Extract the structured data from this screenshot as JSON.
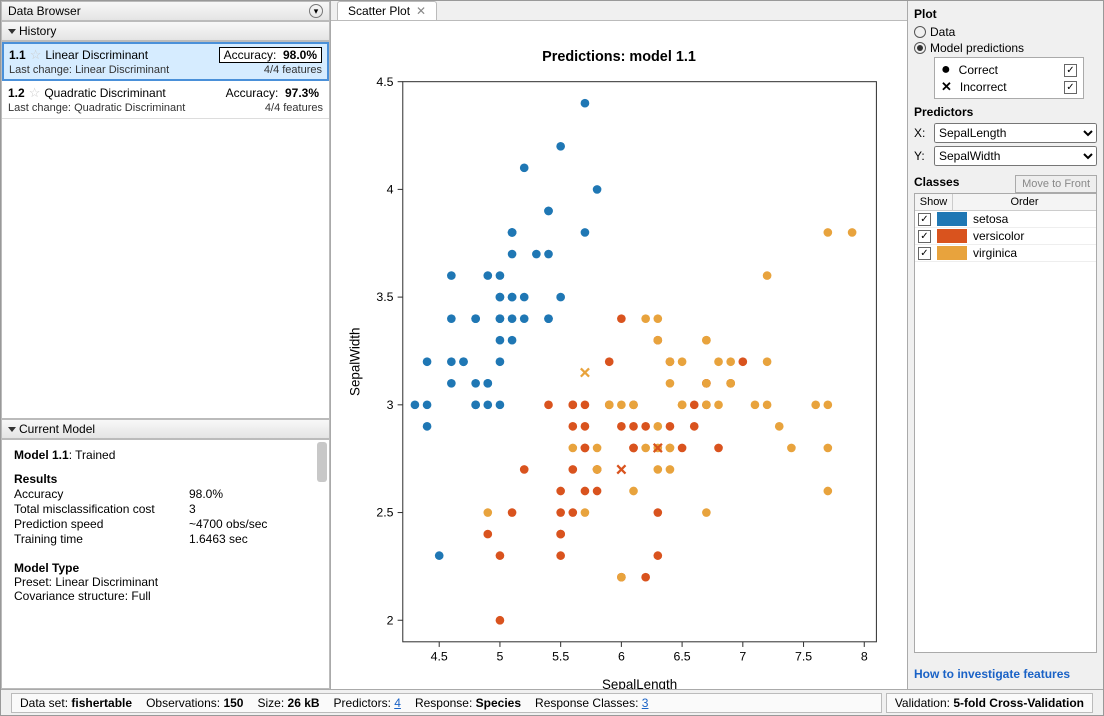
{
  "data_browser_title": "Data Browser",
  "history": {
    "title": "History",
    "items": [
      {
        "id": "1.1",
        "name": "Linear Discriminant",
        "accuracy_label": "Accuracy:",
        "accuracy": "98.0%",
        "last_change_label": "Last change:",
        "last_change": "Linear Discriminant",
        "features": "4/4 features",
        "selected": true
      },
      {
        "id": "1.2",
        "name": "Quadratic Discriminant",
        "accuracy_label": "Accuracy:",
        "accuracy": "97.3%",
        "last_change_label": "Last change:",
        "last_change": "Quadratic Discriminant",
        "features": "4/4 features",
        "selected": false
      }
    ]
  },
  "current_model": {
    "title": "Current Model",
    "heading_model": "Model 1.1",
    "heading_status": ": Trained",
    "results_label": "Results",
    "rows": [
      {
        "k": "Accuracy",
        "v": "98.0%"
      },
      {
        "k": "Total misclassification cost",
        "v": "3"
      },
      {
        "k": "Prediction speed",
        "v": "~4700 obs/sec"
      },
      {
        "k": "Training time",
        "v": "1.6463 sec"
      }
    ],
    "model_type_label": "Model Type",
    "preset": "Preset: Linear Discriminant",
    "cov": "Covariance structure: Full"
  },
  "tab": {
    "label": "Scatter Plot"
  },
  "plot_panel": {
    "title": "Plot",
    "radio_data": "Data",
    "radio_model": "Model predictions",
    "legend_correct": "Correct",
    "legend_incorrect": "Incorrect"
  },
  "predictors_panel": {
    "title": "Predictors",
    "x_label": "X:",
    "y_label": "Y:",
    "x_value": "SepalLength",
    "y_value": "SepalWidth"
  },
  "classes_panel": {
    "title": "Classes",
    "move_btn": "Move to Front",
    "col_show": "Show",
    "col_order": "Order",
    "rows": [
      {
        "name": "setosa",
        "color": "#1f77b4"
      },
      {
        "name": "versicolor",
        "color": "#d9531e"
      },
      {
        "name": "virginica",
        "color": "#e8a33d"
      }
    ]
  },
  "help_link": "How to investigate features",
  "status": {
    "dataset_label": "Data set:",
    "dataset": "fishertable",
    "obs_label": "Observations:",
    "obs": "150",
    "size_label": "Size:",
    "size": "26 kB",
    "pred_label": "Predictors:",
    "pred": "4",
    "resp_label": "Response:",
    "resp": "Species",
    "respcls_label": "Response Classes:",
    "respcls": "3",
    "val_label": "Validation:",
    "val": "5-fold Cross-Validation"
  },
  "chart_data": {
    "type": "scatter",
    "title": "Predictions: model 1.1",
    "xlabel": "SepalLength",
    "ylabel": "SepalWidth",
    "xlim": [
      4.2,
      8.1
    ],
    "ylim": [
      1.9,
      4.5
    ],
    "xticks": [
      4.5,
      5,
      5.5,
      6,
      6.5,
      7,
      7.5,
      8
    ],
    "yticks": [
      2,
      2.5,
      3,
      3.5,
      4,
      4.5
    ],
    "series": [
      {
        "name": "setosa",
        "color": "#1f77b4",
        "symbol": "dot",
        "points": [
          [
            5.1,
            3.5
          ],
          [
            4.9,
            3.0
          ],
          [
            4.7,
            3.2
          ],
          [
            4.6,
            3.1
          ],
          [
            5.0,
            3.6
          ],
          [
            5.4,
            3.9
          ],
          [
            4.6,
            3.4
          ],
          [
            5.0,
            3.4
          ],
          [
            4.4,
            2.9
          ],
          [
            4.9,
            3.1
          ],
          [
            5.4,
            3.7
          ],
          [
            4.8,
            3.4
          ],
          [
            4.8,
            3.0
          ],
          [
            4.3,
            3.0
          ],
          [
            5.8,
            4.0
          ],
          [
            5.7,
            4.4
          ],
          [
            5.4,
            3.9
          ],
          [
            5.1,
            3.5
          ],
          [
            5.7,
            3.8
          ],
          [
            5.1,
            3.8
          ],
          [
            5.4,
            3.4
          ],
          [
            5.1,
            3.7
          ],
          [
            4.6,
            3.6
          ],
          [
            5.1,
            3.3
          ],
          [
            4.8,
            3.4
          ],
          [
            5.0,
            3.0
          ],
          [
            5.0,
            3.4
          ],
          [
            5.2,
            3.5
          ],
          [
            5.2,
            3.4
          ],
          [
            4.7,
            3.2
          ],
          [
            4.8,
            3.1
          ],
          [
            5.4,
            3.4
          ],
          [
            5.2,
            4.1
          ],
          [
            5.5,
            4.2
          ],
          [
            4.9,
            3.1
          ],
          [
            5.0,
            3.2
          ],
          [
            5.5,
            3.5
          ],
          [
            4.9,
            3.6
          ],
          [
            4.4,
            3.0
          ],
          [
            5.1,
            3.4
          ],
          [
            5.0,
            3.5
          ],
          [
            4.5,
            2.3
          ],
          [
            4.4,
            3.2
          ],
          [
            5.0,
            3.5
          ],
          [
            5.1,
            3.8
          ],
          [
            4.8,
            3.0
          ],
          [
            5.1,
            3.8
          ],
          [
            4.6,
            3.2
          ],
          [
            5.3,
            3.7
          ],
          [
            5.0,
            3.3
          ]
        ]
      },
      {
        "name": "versicolor",
        "color": "#d9531e",
        "symbol": "dot",
        "points": [
          [
            7.0,
            3.2
          ],
          [
            6.4,
            3.2
          ],
          [
            6.9,
            3.1
          ],
          [
            5.5,
            2.3
          ],
          [
            6.5,
            2.8
          ],
          [
            5.7,
            2.8
          ],
          [
            6.3,
            3.3
          ],
          [
            4.9,
            2.4
          ],
          [
            6.6,
            2.9
          ],
          [
            5.2,
            2.7
          ],
          [
            5.0,
            2.0
          ],
          [
            5.9,
            3.0
          ],
          [
            6.0,
            2.2
          ],
          [
            6.1,
            2.9
          ],
          [
            5.6,
            2.9
          ],
          [
            6.7,
            3.1
          ],
          [
            5.6,
            3.0
          ],
          [
            5.8,
            2.7
          ],
          [
            6.2,
            2.2
          ],
          [
            5.6,
            2.5
          ],
          [
            5.9,
            3.2
          ],
          [
            6.1,
            2.8
          ],
          [
            6.3,
            2.5
          ],
          [
            6.1,
            2.8
          ],
          [
            6.4,
            2.9
          ],
          [
            6.6,
            3.0
          ],
          [
            6.8,
            2.8
          ],
          [
            6.7,
            3.0
          ],
          [
            6.0,
            2.9
          ],
          [
            5.7,
            2.6
          ],
          [
            5.5,
            2.4
          ],
          [
            5.5,
            2.4
          ],
          [
            5.8,
            2.7
          ],
          [
            5.4,
            3.0
          ],
          [
            6.0,
            3.4
          ],
          [
            6.7,
            3.1
          ],
          [
            6.3,
            2.3
          ],
          [
            5.6,
            3.0
          ],
          [
            5.5,
            2.5
          ],
          [
            5.5,
            2.6
          ],
          [
            6.1,
            3.0
          ],
          [
            5.8,
            2.6
          ],
          [
            5.0,
            2.3
          ],
          [
            5.6,
            2.7
          ],
          [
            5.7,
            3.0
          ],
          [
            5.7,
            2.9
          ],
          [
            6.2,
            2.9
          ],
          [
            5.1,
            2.5
          ],
          [
            5.7,
            2.8
          ]
        ]
      },
      {
        "name": "virginica",
        "color": "#e8a33d",
        "symbol": "dot",
        "points": [
          [
            6.3,
            3.3
          ],
          [
            5.8,
            2.7
          ],
          [
            7.1,
            3.0
          ],
          [
            6.3,
            2.9
          ],
          [
            6.5,
            3.0
          ],
          [
            7.6,
            3.0
          ],
          [
            4.9,
            2.5
          ],
          [
            7.3,
            2.9
          ],
          [
            6.7,
            2.5
          ],
          [
            7.2,
            3.6
          ],
          [
            6.5,
            3.2
          ],
          [
            6.4,
            2.7
          ],
          [
            6.8,
            3.0
          ],
          [
            5.7,
            2.5
          ],
          [
            5.8,
            2.8
          ],
          [
            6.4,
            3.2
          ],
          [
            6.5,
            3.0
          ],
          [
            7.7,
            3.8
          ],
          [
            7.7,
            2.6
          ],
          [
            6.0,
            2.2
          ],
          [
            6.9,
            3.2
          ],
          [
            5.6,
            2.8
          ],
          [
            7.7,
            2.8
          ],
          [
            6.3,
            2.7
          ],
          [
            6.7,
            3.3
          ],
          [
            7.2,
            3.2
          ],
          [
            6.2,
            2.8
          ],
          [
            6.1,
            3.0
          ],
          [
            6.4,
            2.8
          ],
          [
            7.2,
            3.0
          ],
          [
            7.4,
            2.8
          ],
          [
            7.9,
            3.8
          ],
          [
            6.4,
            2.8
          ],
          [
            6.3,
            2.8
          ],
          [
            6.1,
            2.6
          ],
          [
            7.7,
            3.0
          ],
          [
            6.3,
            3.4
          ],
          [
            6.4,
            3.1
          ],
          [
            6.0,
            3.0
          ],
          [
            6.9,
            3.1
          ],
          [
            6.7,
            3.1
          ],
          [
            6.9,
            3.1
          ],
          [
            5.8,
            2.7
          ],
          [
            6.8,
            3.2
          ],
          [
            6.7,
            3.3
          ],
          [
            6.7,
            3.0
          ],
          [
            6.5,
            3.0
          ],
          [
            6.2,
            3.4
          ],
          [
            5.9,
            3.0
          ]
        ]
      },
      {
        "name": "incorrect",
        "color_match_class": true,
        "symbol": "x",
        "points": [
          [
            6.0,
            2.7,
            "#d9531e"
          ],
          [
            5.7,
            3.15,
            "#e8a33d"
          ],
          [
            6.3,
            2.8,
            "#d9531e"
          ]
        ]
      }
    ]
  }
}
